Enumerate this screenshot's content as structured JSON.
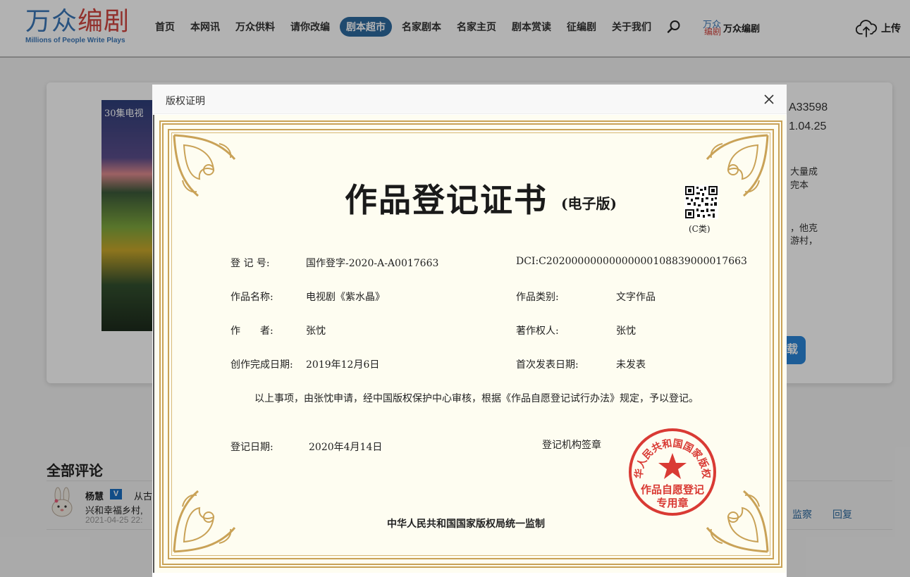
{
  "header": {
    "logo_text_blue": "万众",
    "logo_text_red": "编剧",
    "logo_subtitle": "Millions of People Write Plays",
    "nav": [
      {
        "label": "首页"
      },
      {
        "label": "本网讯"
      },
      {
        "label": "万众供料"
      },
      {
        "label": "请你改编"
      },
      {
        "label": "剧本超市",
        "active": true
      },
      {
        "label": "名家剧本"
      },
      {
        "label": "名家主页"
      },
      {
        "label": "剧本赏读"
      },
      {
        "label": "征编剧"
      },
      {
        "label": "关于我们"
      }
    ],
    "brand_mini_top": "万众",
    "brand_mini_bottom": "编剧",
    "brand_label": "万众编剧",
    "upload_label": "上传"
  },
  "background": {
    "poster_title": "30集电视",
    "side_line1": "A33598",
    "side_line2": "1.04.25",
    "side_line3": "大量成",
    "side_line4": "完本",
    "side_line5": "，他克",
    "side_line6": "游村，",
    "blue_button_label": "载"
  },
  "comments": {
    "section_title": "全部评论",
    "user": "杨慧",
    "vbadge": "V",
    "snippet1": "从古",
    "snippet2": "兴和幸福乡村,",
    "date": "2021-04-25 22:",
    "action_report": "监察",
    "action_reply": "回复"
  },
  "modal": {
    "title": "版权证明",
    "close_label": "×"
  },
  "certificate": {
    "title": "作品登记证书",
    "title_suffix": "(电子版)",
    "qr_label": "(C类)",
    "reg_no_label": "登 记 号:",
    "reg_no_value": "国作登字-2020-A-A0017663",
    "dci": "DCI:C20200000000000000108839000017663",
    "work_name_label": "作品名称:",
    "work_name_value": "电视剧《紫水晶》",
    "work_type_label": "作品类别:",
    "work_type_value": "文字作品",
    "author_label": "作　　者:",
    "author_value": "张忱",
    "copyright_owner_label": "著作权人:",
    "copyright_owner_value": "张忱",
    "completion_date_label": "创作完成日期:",
    "completion_date_value": "2019年12月6日",
    "first_pub_label": "首次发表日期:",
    "first_pub_value": "未发表",
    "paragraph": "以上事项，由张忱申请，经中国版权保护中心审核，根据《作品自愿登记试行办法》规定，予以登记。",
    "reg_date_label": "登记日期:",
    "reg_date_value": "2020年4月14日",
    "seal_label": "登记机构签章",
    "seal_ring_text": "中华人民共和国国家版权局",
    "seal_center_line1": "作品自愿登记",
    "seal_center_line2": "专用章",
    "footer": "中华人民共和国国家版权局统一监制"
  },
  "colors": {
    "accent": "#2d6aa0",
    "gold": "#c9a257",
    "seal_red": "#d93a34",
    "cert_bg": "#fefdf1"
  }
}
